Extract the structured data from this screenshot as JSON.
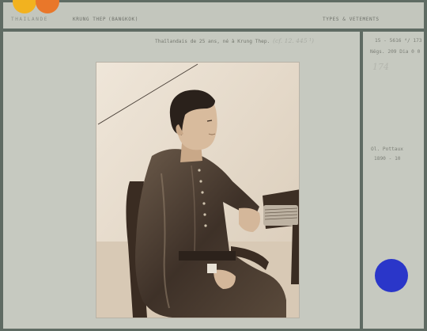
{
  "header": {
    "country": "THAILANDE",
    "city": "KRUNG THEP",
    "region": "(BANGKOK)",
    "category": "TYPES & VETEMENTS"
  },
  "caption": {
    "typed": "Thaïlandais de 25 ans, né à Krung Thep.",
    "handwritten": "(cf. 12. 445 ¹)"
  },
  "side": {
    "cote": "15 - 5616 ⁴/ 173",
    "number": "Négs. 209  Dia 0 0",
    "handwritten_number": "174",
    "author": "Ol. Pottaux",
    "date": "1890 - 10"
  },
  "colors": {
    "background": "#5f6b63",
    "card": "#c6c9c0",
    "dot_yellow": "#f2b21f",
    "dot_orange": "#e9772a",
    "dot_blue": "#2a36c9"
  },
  "photo": {
    "subject": "seated young man in profile, photograph"
  }
}
